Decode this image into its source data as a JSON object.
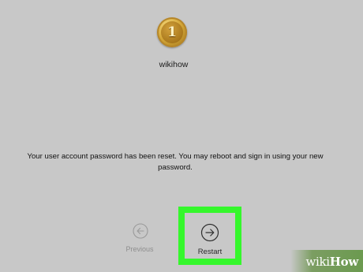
{
  "account": {
    "avatar_glyph": "1",
    "username": "wikihow"
  },
  "notice": {
    "message": "Your user account password has been reset. You may reboot and sign in using your new password."
  },
  "buttons": {
    "previous_label": "Previous",
    "restart_label": "Restart"
  },
  "icons": {
    "previous": "arrow-left-circle-icon",
    "restart": "arrow-right-circle-icon"
  },
  "highlight_color": "#35f72c",
  "watermark": {
    "part1": "wiki",
    "part2": "How"
  }
}
